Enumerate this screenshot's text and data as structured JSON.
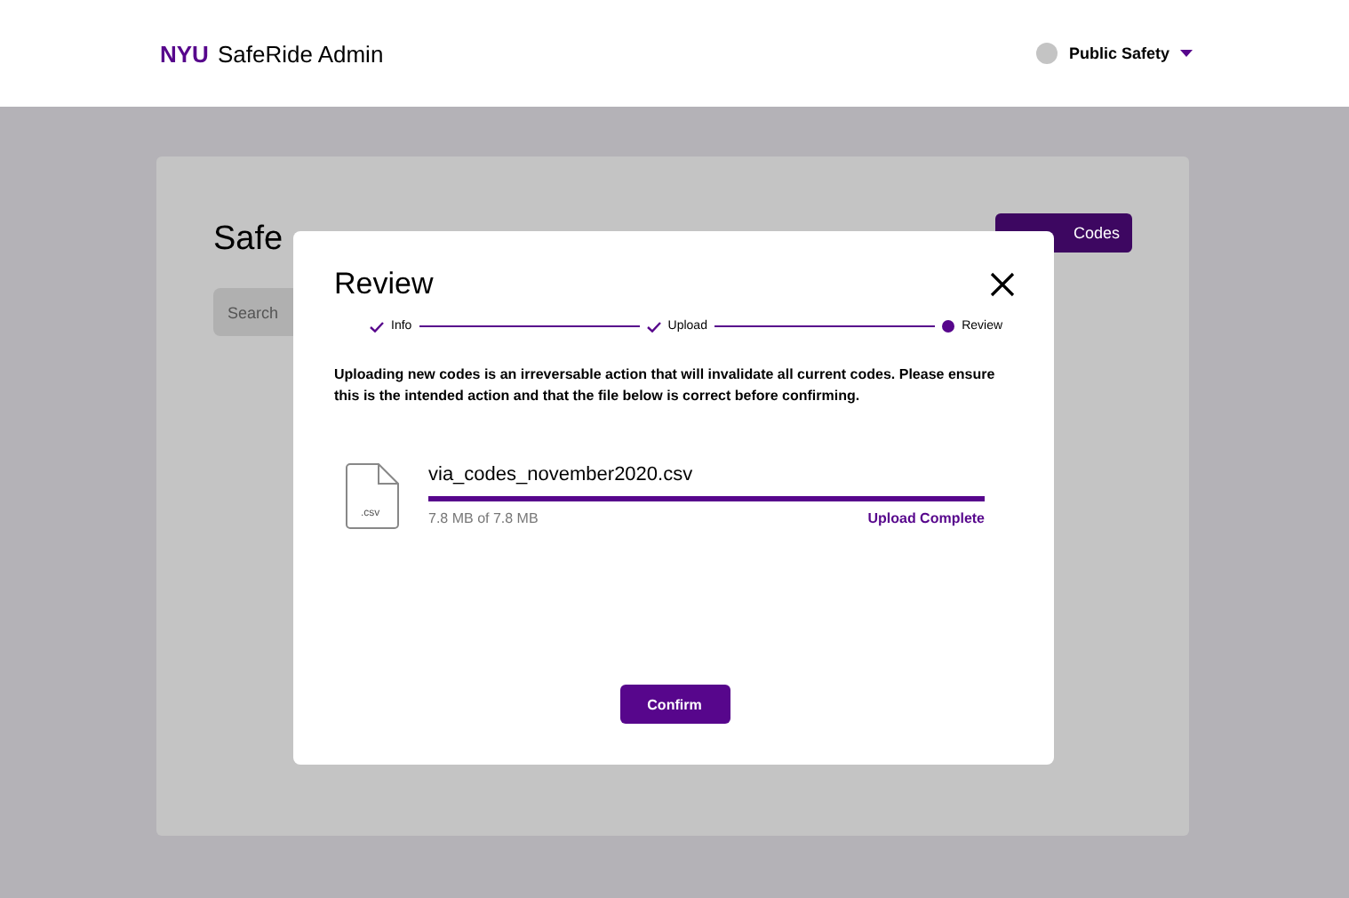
{
  "header": {
    "brand": "NYU",
    "title": "SafeRide Admin",
    "user": "Public Safety"
  },
  "page": {
    "title": "Safe",
    "upload_button": "Codes",
    "search": {
      "placeholder": "Search"
    }
  },
  "modal": {
    "title": "Review",
    "steps": [
      {
        "label": "Info",
        "kind": "done"
      },
      {
        "label": "Upload",
        "kind": "done"
      },
      {
        "label": "Review",
        "kind": "current"
      }
    ],
    "message": "Uploading new codes is an irreversable action that will invalidate all current codes. Please ensure this is the intended action and that the file below is correct before confirming.",
    "file": {
      "icon_label": ".csv",
      "name": "via_codes_november2020.csv",
      "level": 1,
      "size": "7.8 MB of 7.8 MB",
      "status": "Upload Complete"
    },
    "confirm": "Confirm"
  }
}
